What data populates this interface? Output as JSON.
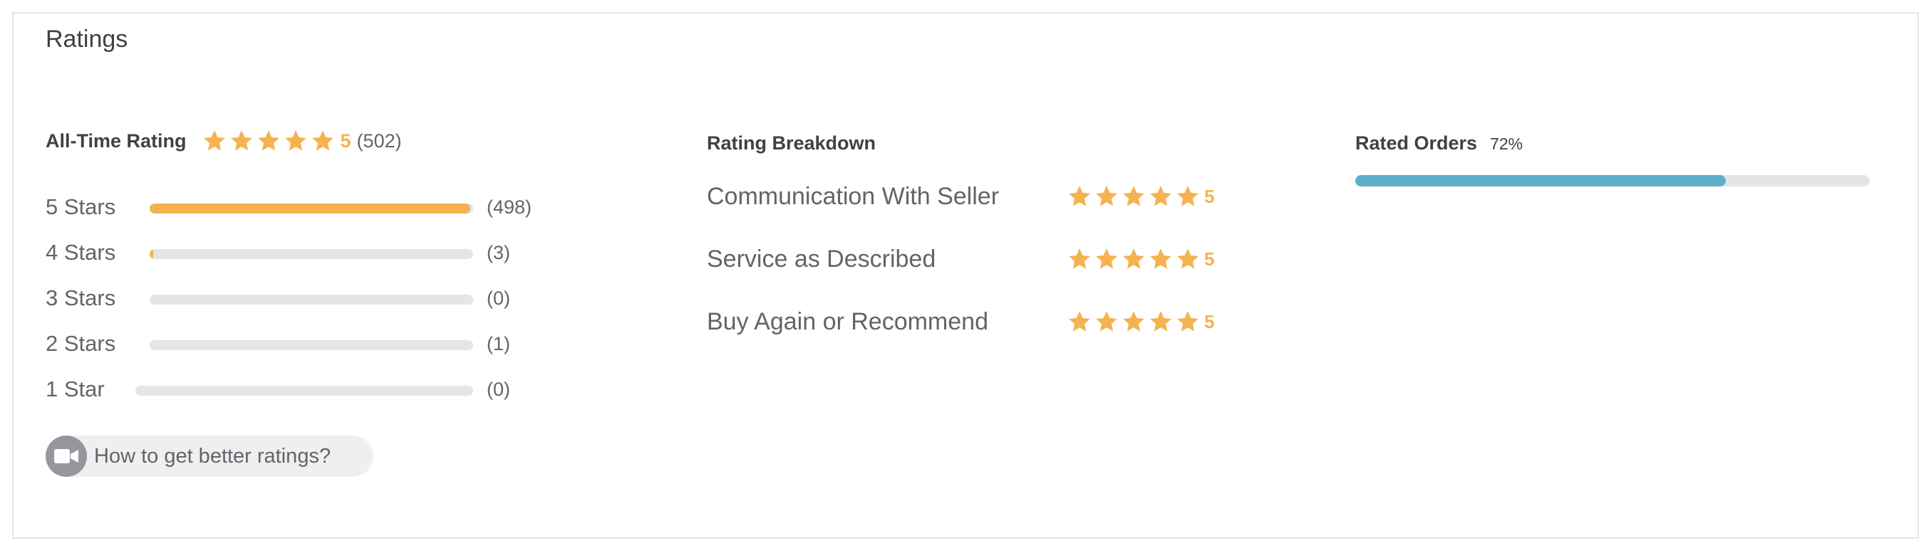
{
  "title": "Ratings",
  "colors": {
    "star": "#f4b350",
    "rated_bar": "#5dafc9",
    "track": "#e4e5e7"
  },
  "all_time": {
    "heading": "All-Time Rating",
    "stars_filled": 5,
    "score": "5",
    "count": "(502)"
  },
  "distribution": [
    {
      "label": "5 Stars",
      "count": "(498)",
      "fraction": 0.992
    },
    {
      "label": "4 Stars",
      "count": "(3)",
      "fraction": 0.006
    },
    {
      "label": "3 Stars",
      "count": "(0)",
      "fraction": 0
    },
    {
      "label": "2 Stars",
      "count": "(1)",
      "fraction": 0
    },
    {
      "label": "1 Star",
      "count": "(0)",
      "fraction": 0
    }
  ],
  "help": {
    "label": "How to get better ratings?",
    "icon": "video-camera-icon"
  },
  "breakdown": {
    "heading": "Rating Breakdown",
    "items": [
      {
        "label": "Communication With Seller",
        "score": "5",
        "stars_filled": 5
      },
      {
        "label": "Service as Described",
        "score": "5",
        "stars_filled": 5
      },
      {
        "label": "Buy Again or Recommend",
        "score": "5",
        "stars_filled": 5
      }
    ]
  },
  "rated_orders": {
    "heading": "Rated Orders",
    "percent_label": "72%",
    "fraction": 0.72
  }
}
